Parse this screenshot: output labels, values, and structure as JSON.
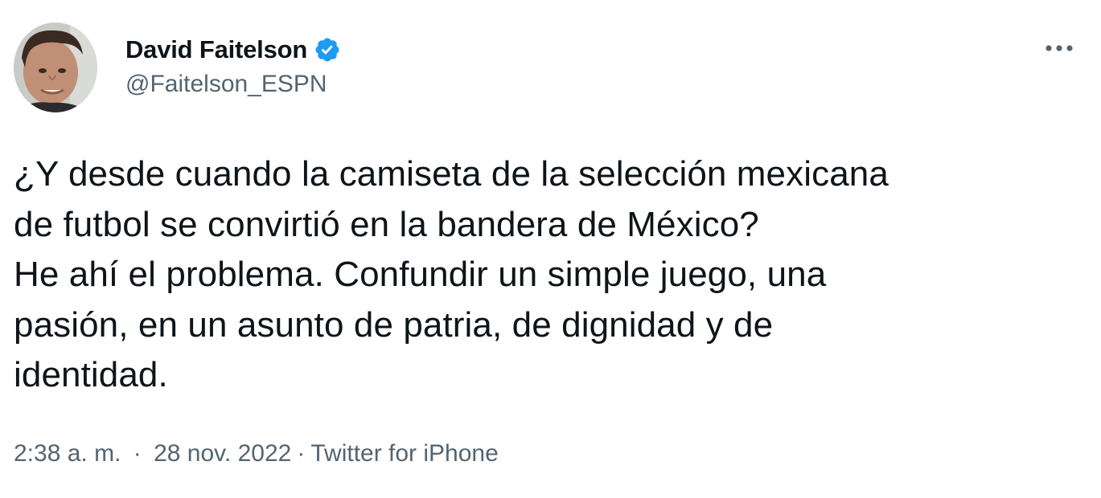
{
  "tweet": {
    "author": {
      "display_name": "David Faitelson",
      "handle": "@Faitelson_ESPN",
      "verified": true,
      "avatar_icon": "profile-photo"
    },
    "more_icon": "more-horizontal-icon",
    "text": "¿Y desde cuando la camiseta de la selección mexicana\nde futbol se convirtió en la bandera de México?\nHe ahí el problema. Confundir un simple juego, una\npasión, en un asunto de patria, de dignidad y de\nidentidad.",
    "time": "2:38 a. m.",
    "separator": "·",
    "date": "28 nov. 2022",
    "source": "Twitter for iPhone"
  },
  "colors": {
    "text_primary": "#0f1419",
    "text_secondary": "#536471",
    "verified_blue": "#1d9bf0",
    "background": "#ffffff"
  }
}
